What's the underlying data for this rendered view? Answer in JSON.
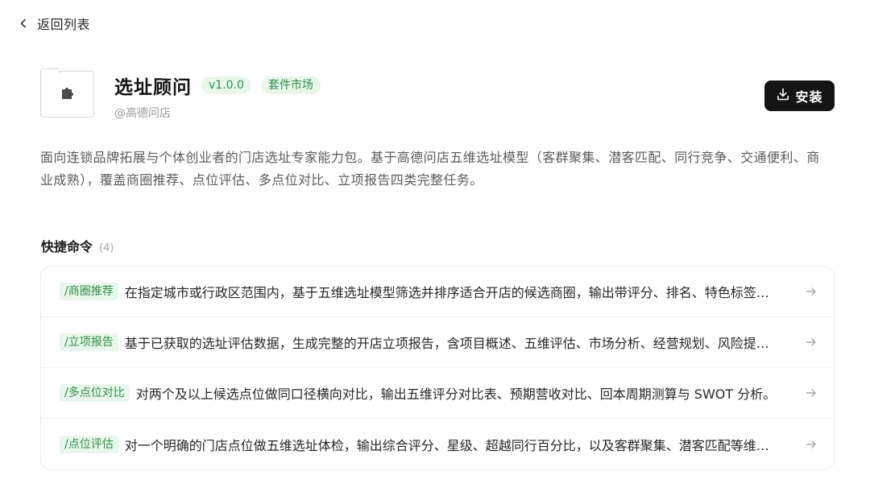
{
  "nav": {
    "back_label": "返回列表"
  },
  "plugin": {
    "icon": "puzzle-piece-icon",
    "title": "选址顾问",
    "version": "v1.0.0",
    "source_badge": "套件市场",
    "author": "@高德问店",
    "install_label": "安装",
    "install_icon": "download-icon",
    "description": "面向连锁品牌拓展与个体创业者的门店选址专家能力包。基于高德问店五维选址模型（客群聚集、潜客匹配、同行竞争、交通便利、商业成熟），覆盖商圈推荐、点位评估、多点位对比、立项报告四类完整任务。"
  },
  "commands": {
    "title": "快捷命令",
    "count_label": "(4)",
    "items": [
      {
        "tag": "/商圈推荐",
        "description": "在指定城市或行政区范围内，基于五维选址模型筛选并排序适合开店的候选商圈，输出带评分、排名、特色标签的推荐列表。"
      },
      {
        "tag": "/立项报告",
        "description": "基于已获取的选址评估数据，生成完整的开店立项报告，含项目概述、五维评估、市场分析、经营规划、风险提示等章节。"
      },
      {
        "tag": "/多点位对比",
        "description": "对两个及以上候选点位做同口径横向对比，输出五维评分对比表、预期营收对比、回本周期测算与 SWOT 分析。"
      },
      {
        "tag": "/点位评估",
        "description": "对一个明确的门店点位做五维选址体检，输出综合评分、星级、超越同行百分比，以及客群聚集、潜客匹配等维度解读。"
      }
    ]
  },
  "colors": {
    "accent_green": "#2f8f46",
    "accent_green_bg": "#e9f6ec",
    "primary_button": "#141414"
  }
}
